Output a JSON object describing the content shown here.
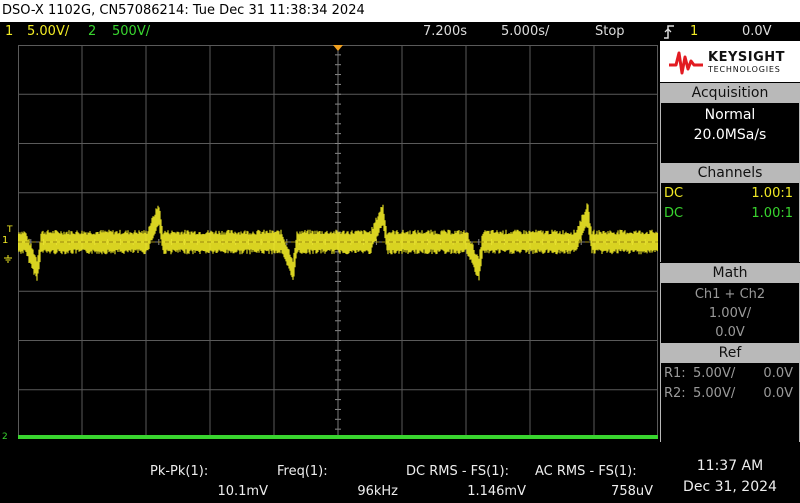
{
  "title_bar": {
    "text": "DSO-X 1102G, CN57086214: Tue Dec 31 11:38:34 2024"
  },
  "status": {
    "ch1_num": "1",
    "ch1_scale": "5.00V/",
    "ch2_num": "2",
    "ch2_scale": "500V/",
    "time_offset": "7.200s",
    "time_scale": "5.000s/",
    "run_state": "Stop",
    "trigger_icon": "trigger-edge-icon",
    "trigger_channel": "1",
    "trigger_level": "0.0V"
  },
  "markers": {
    "trigger_t": "T",
    "ch1_marker": "1",
    "ch2_marker": "2"
  },
  "logo": {
    "line1": "KEYSIGHT",
    "line2": "TECHNOLOGIES"
  },
  "acquisition": {
    "header": "Acquisition",
    "mode": "Normal",
    "rate": "20.0MSa/s"
  },
  "channels": {
    "header": "Channels",
    "rows": [
      {
        "coupling": "DC",
        "probe": "1.00:1"
      },
      {
        "coupling": "DC",
        "probe": "1.00:1"
      }
    ]
  },
  "math": {
    "header": "Math",
    "function": "Ch1 + Ch2",
    "scale": "1.00V/",
    "offset": "0.0V"
  },
  "ref": {
    "header": "Ref",
    "rows": [
      {
        "name": "R1:",
        "scale": "5.00V/",
        "offset": "0.0V"
      },
      {
        "name": "R2:",
        "scale": "5.00V/",
        "offset": "0.0V"
      }
    ]
  },
  "measurements": [
    {
      "label": "Pk-Pk(1):",
      "value": "10.1mV"
    },
    {
      "label": "Freq(1):",
      "value": "96kHz"
    },
    {
      "label": "DC RMS - FS(1):",
      "value": "1.146mV"
    },
    {
      "label": "AC RMS - FS(1):",
      "value": "758uV"
    }
  ],
  "clock": {
    "time": "11:37 AM",
    "date": "Dec 31, 2024"
  },
  "colors": {
    "ch1": "#f1ea25",
    "ch2": "#39d52f",
    "grid": "#5a5a5a",
    "panel_header": "#b9b9b9"
  },
  "chart_data": {
    "type": "line",
    "title": "",
    "xlabel": "",
    "ylabel": "",
    "x_divisions": 10,
    "y_divisions": 8,
    "series": [
      {
        "channel": "1",
        "noise_band_divisions": 0.5,
        "glitch_positions_div": [
          0.3,
          2.2,
          4.3,
          5.7,
          7.2,
          8.9
        ],
        "glitch_polarity": [
          -1,
          1,
          -1,
          1,
          -1,
          1
        ]
      },
      {
        "channel": "2",
        "level_divisions": -4.0
      }
    ]
  }
}
